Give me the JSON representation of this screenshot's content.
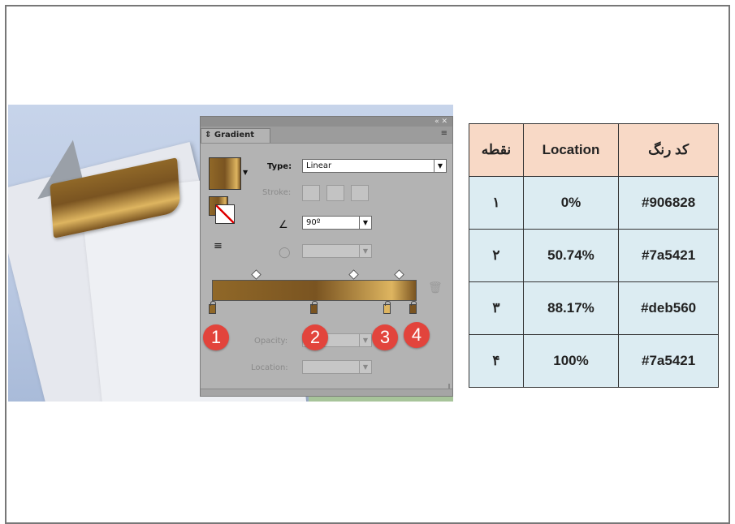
{
  "panel": {
    "title": "Gradient",
    "top_controls": "« ✕",
    "menu_icon": "≡",
    "type_label": "Type:",
    "type_value": "Linear",
    "stroke_label": "Stroke:",
    "angle_value": "90º",
    "opacity_label": "Opacity:",
    "location_label": "Location:",
    "gradient_stops": [
      {
        "location": 0,
        "color": "#906828"
      },
      {
        "location": 50.74,
        "color": "#7a5421"
      },
      {
        "location": 88.17,
        "color": "#deb560"
      },
      {
        "location": 100,
        "color": "#7a5421"
      }
    ]
  },
  "badges": [
    "1",
    "2",
    "3",
    "4"
  ],
  "table": {
    "headers": {
      "point": "نقطه",
      "location": "Location",
      "color": "کد رنگ"
    },
    "rows": [
      {
        "point": "۱",
        "location": "0%",
        "color": "#906828"
      },
      {
        "point": "۲",
        "location": "50.74%",
        "color": "#7a5421"
      },
      {
        "point": "۳",
        "location": "88.17%",
        "color": "#deb560"
      },
      {
        "point": "۴",
        "location": "100%",
        "color": "#7a5421"
      }
    ]
  },
  "colors": {
    "badge": "#e2443c",
    "header_bg": "#f8d9c6",
    "cell_bg": "#dcecf2"
  }
}
